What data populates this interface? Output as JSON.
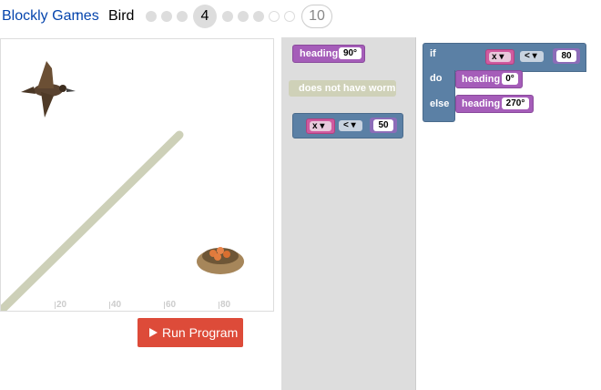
{
  "header": {
    "site_link": "Blockly Games",
    "separator": ":",
    "game_name": "Bird",
    "current_level": "4",
    "last_level": "10"
  },
  "game": {
    "x_axis_ticks": [
      "20",
      "40",
      "60",
      "80"
    ],
    "wall_color": "#cdd0b8"
  },
  "run_button": {
    "label": "Run Program",
    "color": "#dd4b39"
  },
  "toolbox": {
    "heading_label": "heading",
    "heading_value": "90°",
    "worm_label": "does not have worm",
    "compare_var": "x",
    "compare_op": "<",
    "compare_value": "50"
  },
  "workspace": {
    "if_label": "if",
    "do_label": "do",
    "else_label": "else",
    "cond_var": "x",
    "cond_op": "<",
    "cond_value": "80",
    "do_heading_label": "heading",
    "do_heading_value": "0°",
    "else_heading_label": "heading",
    "else_heading_value": "270°"
  },
  "colors": {
    "heading_block": "#a55db9",
    "logic_block": "#5b80a5",
    "sensor_block": "#cfd1b8"
  }
}
